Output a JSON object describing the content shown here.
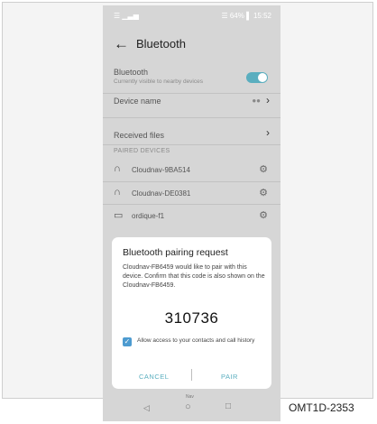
{
  "statusbar": {
    "left": "☰ ▁▃▅",
    "right": "☰ 64% ▌ 15:52"
  },
  "header": {
    "back_icon": "←",
    "title": "Bluetooth"
  },
  "bluetooth_row": {
    "label": "Bluetooth",
    "sublabel": "Currently visible to nearby devices",
    "enabled": true
  },
  "device_name_row": {
    "label": "Device name",
    "value": "●●"
  },
  "received_files_row": {
    "label": "Received files"
  },
  "paired_devices": {
    "header": "PAIRED DEVICES",
    "items": [
      {
        "name": "Cloudnav-9BA514",
        "icon": "headset-icon"
      },
      {
        "name": "Cloudnav-DE0381",
        "icon": "headset-icon"
      },
      {
        "name": "ordique-f1",
        "icon": "laptop-icon"
      }
    ]
  },
  "dialog": {
    "title": "Bluetooth pairing request",
    "message": "Cloudnav-FB6459 would like to pair with this device. Confirm that this code is also shown on the Cloudnav-FB6459.",
    "code": "310736",
    "checkbox_checked": true,
    "checkbox_label": "Allow access to your contacts and call history",
    "cancel_label": "CANCEL",
    "pair_label": "PAIR"
  },
  "navbar": {
    "label": "Nav",
    "back_icon": "◁",
    "home_icon": "○",
    "recent_icon": "□"
  },
  "figure_ref": "OMT1D-2353",
  "colors": {
    "accent": "#5aaebf",
    "checkbox": "#4d9bd0"
  }
}
